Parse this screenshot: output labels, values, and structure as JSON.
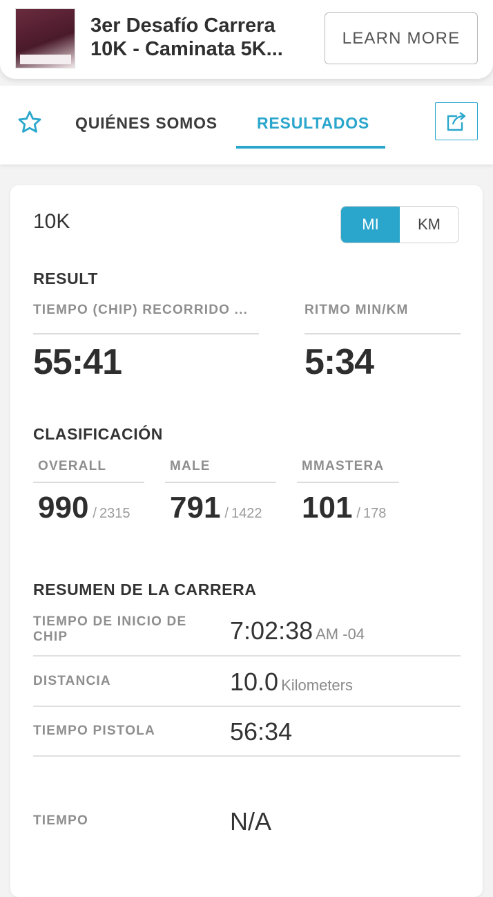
{
  "banner": {
    "title_line1": "3er Desafío Carrera",
    "title_line2": "10K - Caminata 5K...",
    "learn_more": "LEARN MORE"
  },
  "tabs": {
    "about": "QUIÉNES SOMOS",
    "results": "RESULTADOS",
    "active": "results"
  },
  "card": {
    "race_name": "10K",
    "units": {
      "mi": "MI",
      "km": "KM",
      "selected": "mi"
    },
    "result": {
      "title": "RESULT",
      "chip_time_label": "TIEMPO (CHIP) RECORRIDO ...",
      "chip_time_value": "55:41",
      "pace_label": "RITMO MIN/KM",
      "pace_value": "5:34"
    },
    "classification": {
      "title": "CLASIFICACIÓN",
      "items": [
        {
          "label": "OVERALL",
          "place": "990",
          "sep": "/",
          "total": "2315"
        },
        {
          "label": "MALE",
          "place": "791",
          "sep": "/",
          "total": "1422"
        },
        {
          "label": "MMASTERA",
          "place": "101",
          "sep": "/",
          "total": "178"
        }
      ]
    },
    "summary": {
      "title": "RESUMEN DE LA CARRERA",
      "rows": [
        {
          "label": "TIEMPO DE INICIO DE CHIP",
          "value": "7:02:38",
          "suffix": "AM -04"
        },
        {
          "label": "DISTANCIA",
          "value": "10.0",
          "suffix": "Kilometers"
        },
        {
          "label": "TIEMPO PISTOLA",
          "value": "56:34",
          "suffix": ""
        },
        {
          "label": "TIEMPO",
          "value": "N/A",
          "suffix": ""
        }
      ]
    }
  },
  "colors": {
    "accent": "#2aa6cc",
    "banner_thumb": "#5a2034"
  }
}
